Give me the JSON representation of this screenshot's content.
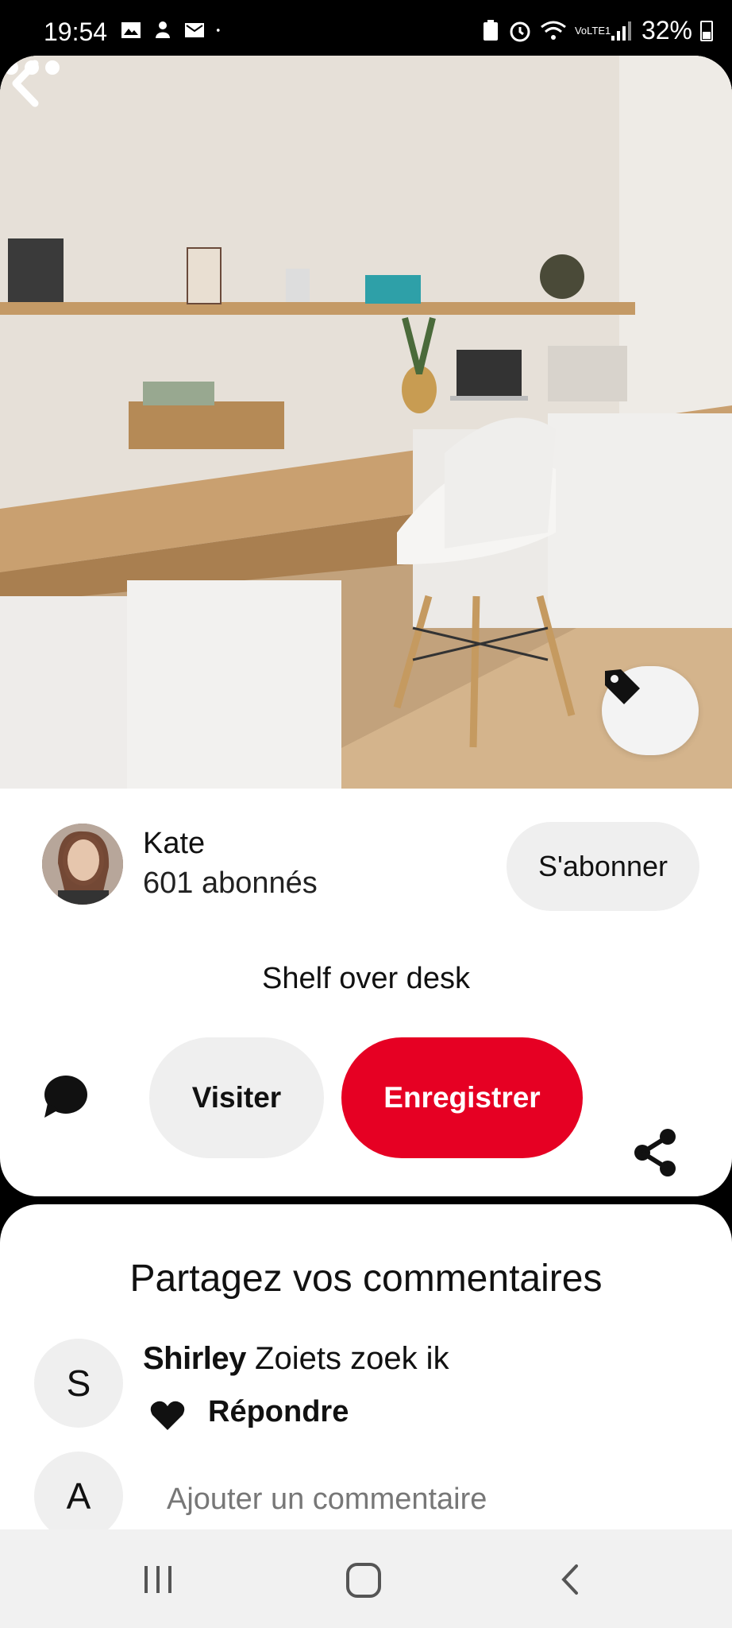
{
  "status_bar": {
    "time": "19:54",
    "battery": "32%",
    "network": "VoLTE1"
  },
  "pin": {
    "image_alt": "White cabinets with wooden desktop and floating shelf, white chair",
    "creator": {
      "name": "Kate",
      "followers": "601 abonnés"
    },
    "follow_label": "S'abonner",
    "title": "Shelf over desk",
    "visit_label": "Visiter",
    "save_label": "Enregistrer",
    "icons": [
      "back-arrow-icon",
      "more-icon",
      "tag-icon",
      "comment-bubble-icon",
      "share-icon"
    ]
  },
  "comments": {
    "heading": "Partagez vos commentaires",
    "items": [
      {
        "avatar_letter": "S",
        "author": "Shirley",
        "text": "Zoiets zoek ik",
        "reply_label": "Répondre"
      }
    ],
    "composer": {
      "avatar_letter": "A",
      "placeholder": "Ajouter un commentaire"
    }
  },
  "colors": {
    "save_red": "#e60023",
    "chip_gray": "#efefef"
  }
}
